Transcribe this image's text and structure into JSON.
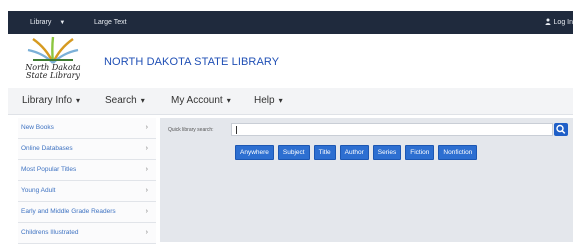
{
  "topbar": {
    "library_label": "Library",
    "large_text_label": "Large Text",
    "login_label": "Log In"
  },
  "header": {
    "logo_text_line1": "North Dakota",
    "logo_text_line2": "State Library",
    "site_title": "NORTH DAKOTA STATE LIBRARY"
  },
  "nav": {
    "items": [
      {
        "label": "Library Info"
      },
      {
        "label": "Search"
      },
      {
        "label": "My Account"
      },
      {
        "label": "Help"
      }
    ]
  },
  "sidebar": {
    "items": [
      {
        "label": "New Books"
      },
      {
        "label": "Online Databases"
      },
      {
        "label": "Most Popular Titles"
      },
      {
        "label": "Young Adult"
      },
      {
        "label": "Early and Middle Grade Readers"
      },
      {
        "label": "Childrens Illustrated"
      }
    ]
  },
  "search": {
    "quick_label": "Quick library search:",
    "placeholder": "",
    "value": "",
    "filters": [
      "Anywhere",
      "Subject",
      "Title",
      "Author",
      "Series",
      "Fiction",
      "Nonfiction"
    ]
  },
  "colors": {
    "topbar_bg": "#1f2a3d",
    "title_blue": "#1f4fb5",
    "button_blue": "#2d6fd1",
    "main_bg": "#e4e7ec"
  }
}
